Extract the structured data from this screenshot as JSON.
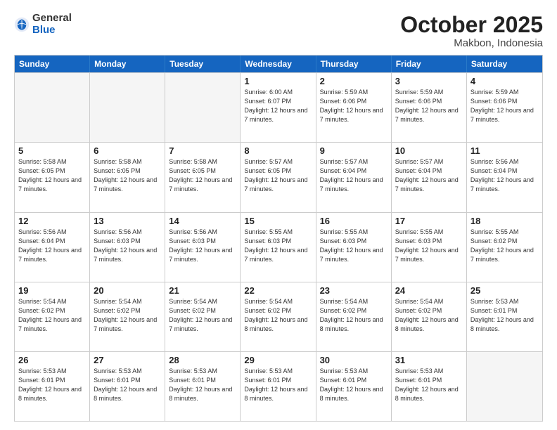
{
  "header": {
    "logo_general": "General",
    "logo_blue": "Blue",
    "month": "October 2025",
    "location": "Makbon, Indonesia"
  },
  "days_of_week": [
    "Sunday",
    "Monday",
    "Tuesday",
    "Wednesday",
    "Thursday",
    "Friday",
    "Saturday"
  ],
  "rows": [
    [
      {
        "day": "",
        "empty": true
      },
      {
        "day": "",
        "empty": true
      },
      {
        "day": "",
        "empty": true
      },
      {
        "day": "1",
        "sunrise": "Sunrise: 6:00 AM",
        "sunset": "Sunset: 6:07 PM",
        "daylight": "Daylight: 12 hours and 7 minutes."
      },
      {
        "day": "2",
        "sunrise": "Sunrise: 5:59 AM",
        "sunset": "Sunset: 6:06 PM",
        "daylight": "Daylight: 12 hours and 7 minutes."
      },
      {
        "day": "3",
        "sunrise": "Sunrise: 5:59 AM",
        "sunset": "Sunset: 6:06 PM",
        "daylight": "Daylight: 12 hours and 7 minutes."
      },
      {
        "day": "4",
        "sunrise": "Sunrise: 5:59 AM",
        "sunset": "Sunset: 6:06 PM",
        "daylight": "Daylight: 12 hours and 7 minutes."
      }
    ],
    [
      {
        "day": "5",
        "sunrise": "Sunrise: 5:58 AM",
        "sunset": "Sunset: 6:05 PM",
        "daylight": "Daylight: 12 hours and 7 minutes."
      },
      {
        "day": "6",
        "sunrise": "Sunrise: 5:58 AM",
        "sunset": "Sunset: 6:05 PM",
        "daylight": "Daylight: 12 hours and 7 minutes."
      },
      {
        "day": "7",
        "sunrise": "Sunrise: 5:58 AM",
        "sunset": "Sunset: 6:05 PM",
        "daylight": "Daylight: 12 hours and 7 minutes."
      },
      {
        "day": "8",
        "sunrise": "Sunrise: 5:57 AM",
        "sunset": "Sunset: 6:05 PM",
        "daylight": "Daylight: 12 hours and 7 minutes."
      },
      {
        "day": "9",
        "sunrise": "Sunrise: 5:57 AM",
        "sunset": "Sunset: 6:04 PM",
        "daylight": "Daylight: 12 hours and 7 minutes."
      },
      {
        "day": "10",
        "sunrise": "Sunrise: 5:57 AM",
        "sunset": "Sunset: 6:04 PM",
        "daylight": "Daylight: 12 hours and 7 minutes."
      },
      {
        "day": "11",
        "sunrise": "Sunrise: 5:56 AM",
        "sunset": "Sunset: 6:04 PM",
        "daylight": "Daylight: 12 hours and 7 minutes."
      }
    ],
    [
      {
        "day": "12",
        "sunrise": "Sunrise: 5:56 AM",
        "sunset": "Sunset: 6:04 PM",
        "daylight": "Daylight: 12 hours and 7 minutes."
      },
      {
        "day": "13",
        "sunrise": "Sunrise: 5:56 AM",
        "sunset": "Sunset: 6:03 PM",
        "daylight": "Daylight: 12 hours and 7 minutes."
      },
      {
        "day": "14",
        "sunrise": "Sunrise: 5:56 AM",
        "sunset": "Sunset: 6:03 PM",
        "daylight": "Daylight: 12 hours and 7 minutes."
      },
      {
        "day": "15",
        "sunrise": "Sunrise: 5:55 AM",
        "sunset": "Sunset: 6:03 PM",
        "daylight": "Daylight: 12 hours and 7 minutes."
      },
      {
        "day": "16",
        "sunrise": "Sunrise: 5:55 AM",
        "sunset": "Sunset: 6:03 PM",
        "daylight": "Daylight: 12 hours and 7 minutes."
      },
      {
        "day": "17",
        "sunrise": "Sunrise: 5:55 AM",
        "sunset": "Sunset: 6:03 PM",
        "daylight": "Daylight: 12 hours and 7 minutes."
      },
      {
        "day": "18",
        "sunrise": "Sunrise: 5:55 AM",
        "sunset": "Sunset: 6:02 PM",
        "daylight": "Daylight: 12 hours and 7 minutes."
      }
    ],
    [
      {
        "day": "19",
        "sunrise": "Sunrise: 5:54 AM",
        "sunset": "Sunset: 6:02 PM",
        "daylight": "Daylight: 12 hours and 7 minutes."
      },
      {
        "day": "20",
        "sunrise": "Sunrise: 5:54 AM",
        "sunset": "Sunset: 6:02 PM",
        "daylight": "Daylight: 12 hours and 7 minutes."
      },
      {
        "day": "21",
        "sunrise": "Sunrise: 5:54 AM",
        "sunset": "Sunset: 6:02 PM",
        "daylight": "Daylight: 12 hours and 7 minutes."
      },
      {
        "day": "22",
        "sunrise": "Sunrise: 5:54 AM",
        "sunset": "Sunset: 6:02 PM",
        "daylight": "Daylight: 12 hours and 8 minutes."
      },
      {
        "day": "23",
        "sunrise": "Sunrise: 5:54 AM",
        "sunset": "Sunset: 6:02 PM",
        "daylight": "Daylight: 12 hours and 8 minutes."
      },
      {
        "day": "24",
        "sunrise": "Sunrise: 5:54 AM",
        "sunset": "Sunset: 6:02 PM",
        "daylight": "Daylight: 12 hours and 8 minutes."
      },
      {
        "day": "25",
        "sunrise": "Sunrise: 5:53 AM",
        "sunset": "Sunset: 6:01 PM",
        "daylight": "Daylight: 12 hours and 8 minutes."
      }
    ],
    [
      {
        "day": "26",
        "sunrise": "Sunrise: 5:53 AM",
        "sunset": "Sunset: 6:01 PM",
        "daylight": "Daylight: 12 hours and 8 minutes."
      },
      {
        "day": "27",
        "sunrise": "Sunrise: 5:53 AM",
        "sunset": "Sunset: 6:01 PM",
        "daylight": "Daylight: 12 hours and 8 minutes."
      },
      {
        "day": "28",
        "sunrise": "Sunrise: 5:53 AM",
        "sunset": "Sunset: 6:01 PM",
        "daylight": "Daylight: 12 hours and 8 minutes."
      },
      {
        "day": "29",
        "sunrise": "Sunrise: 5:53 AM",
        "sunset": "Sunset: 6:01 PM",
        "daylight": "Daylight: 12 hours and 8 minutes."
      },
      {
        "day": "30",
        "sunrise": "Sunrise: 5:53 AM",
        "sunset": "Sunset: 6:01 PM",
        "daylight": "Daylight: 12 hours and 8 minutes."
      },
      {
        "day": "31",
        "sunrise": "Sunrise: 5:53 AM",
        "sunset": "Sunset: 6:01 PM",
        "daylight": "Daylight: 12 hours and 8 minutes."
      },
      {
        "day": "",
        "empty": true
      }
    ]
  ]
}
